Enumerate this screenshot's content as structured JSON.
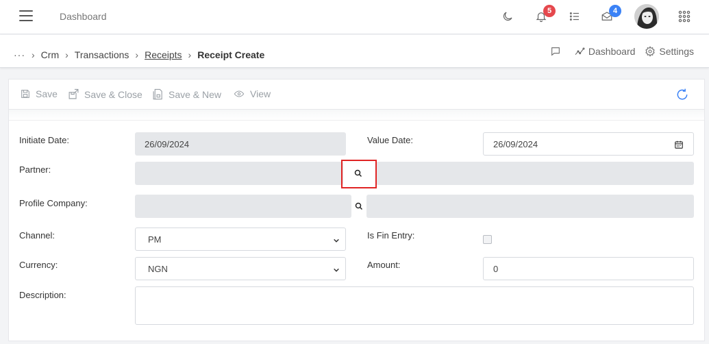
{
  "topbar": {
    "title": "Dashboard",
    "notifications_count": "5",
    "messages_count": "4",
    "icons": [
      "menu-icon",
      "moon-icon",
      "bell-icon",
      "list-icon",
      "mail-icon",
      "apps-icon"
    ]
  },
  "breadcrumb": {
    "more": "···",
    "items": [
      "Crm",
      "Transactions",
      "Receipts",
      "Receipt Create"
    ],
    "actions": {
      "dashboard": "Dashboard",
      "settings": "Settings"
    }
  },
  "toolbar": {
    "save": "Save",
    "save_close": "Save & Close",
    "save_new": "Save & New",
    "view": "View"
  },
  "form": {
    "initiate_date": {
      "label": "Initiate Date:",
      "value": "26/09/2024"
    },
    "value_date": {
      "label": "Value Date:",
      "value": "26/09/2024"
    },
    "partner": {
      "label": "Partner:",
      "value": ""
    },
    "profile_company": {
      "label": "Profile Company:",
      "value": ""
    },
    "channel": {
      "label": "Channel:",
      "value": "PM"
    },
    "is_fin_entry": {
      "label": "Is Fin Entry:",
      "checked": false
    },
    "currency": {
      "label": "Currency:",
      "value": "NGN"
    },
    "amount": {
      "label": "Amount:",
      "value": "0"
    },
    "description": {
      "label": "Description:",
      "value": ""
    }
  },
  "colors": {
    "notification_badge": "#e5484d",
    "message_badge": "#3b82f6",
    "highlight": "#e02424",
    "refresh": "#3b82f6"
  }
}
